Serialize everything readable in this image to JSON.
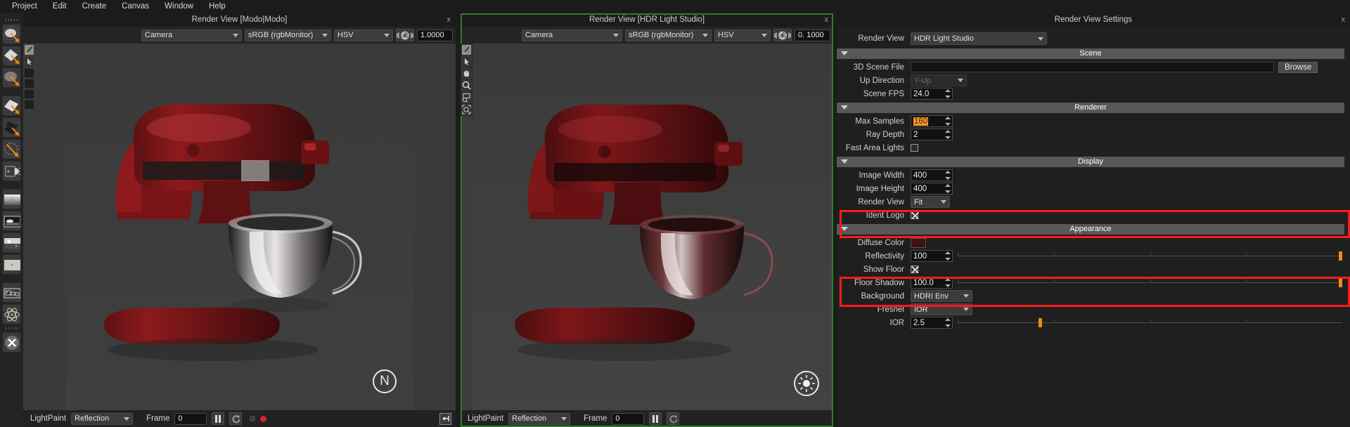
{
  "menubar": {
    "items": [
      "Project",
      "Edit",
      "Create",
      "Canvas",
      "Window",
      "Help"
    ]
  },
  "left_toolbar": {
    "tools": [
      {
        "name": "light-sphere-tool",
        "label": "Sphere Light"
      },
      {
        "name": "light-quad-tool",
        "label": "Quad Light"
      },
      {
        "name": "light-soft-tool",
        "label": "Soft Light"
      },
      {
        "name": "light-plane-tool",
        "label": "Plane Light"
      },
      {
        "name": "light-multi-tool",
        "label": "Multi Light"
      },
      {
        "name": "light-arc-tool",
        "label": "Arc Light"
      },
      {
        "name": "light-gradient-tool",
        "label": "Gradient Light"
      },
      {
        "name": "hdri-gradient-preset",
        "label": "Gradient Map"
      },
      {
        "name": "hdri-env-preset",
        "label": "HDRI Environment"
      },
      {
        "name": "hdri-sky-preset",
        "label": "Sky Preset"
      },
      {
        "name": "hdri-flat-preset",
        "label": "Flat Preset"
      },
      {
        "name": "layer-stack-tool",
        "label": "Layer Stack"
      },
      {
        "name": "atom-render-tool",
        "label": "Render Settings"
      },
      {
        "name": "close-tool",
        "label": "Close"
      }
    ]
  },
  "panel_modo": {
    "title": "Render View [Modo|Modo]",
    "close_label": "x",
    "camera": "Camera",
    "colorspace": "sRGB (rgbMonitor)",
    "mode": "HSV",
    "exposure": "1.0000",
    "exposure_icon": "aperture-icon",
    "bottom": {
      "lightpaint_label": "LightPaint",
      "paint_mode": "Reflection",
      "frame_label": "Frame",
      "frame_value": "0",
      "pause_icon": "pause-icon",
      "refresh_icon": "refresh-icon",
      "status_dot_idle": "idle-dot",
      "status_dot_rec": "record-dot",
      "collapse_icon": "collapse-left-icon"
    },
    "vtools": [
      {
        "name": "brush-tool"
      },
      {
        "name": "pointer-tool"
      },
      {
        "name": "pan-tool"
      },
      {
        "name": "zoom-tool"
      },
      {
        "name": "zoom-region-tool"
      },
      {
        "name": "zoom-fit-tool"
      }
    ],
    "watermark": "N"
  },
  "panel_hdrls": {
    "title": "Render View [HDR Light Studio]",
    "close_label": "x",
    "camera": "Camera",
    "colorspace": "sRGB (rgbMonitor)",
    "mode": "HSV",
    "exposure": "0. 1000",
    "exposure_icon": "aperture-icon",
    "bottom": {
      "lightpaint_label": "LightPaint",
      "paint_mode": "Reflection",
      "frame_label": "Frame",
      "frame_value": "0",
      "pause_icon": "pause-icon",
      "refresh_icon": "refresh-icon"
    },
    "vtools": [
      {
        "name": "brush-tool"
      },
      {
        "name": "pointer-tool"
      },
      {
        "name": "pan-tool"
      },
      {
        "name": "zoom-tool"
      },
      {
        "name": "zoom-region-tool"
      },
      {
        "name": "zoom-fit-tool"
      }
    ],
    "watermark": "sun-icon"
  },
  "settings": {
    "title": "Render View Settings",
    "close_label": "x",
    "render_view": {
      "label": "Render View",
      "value": "HDR Light Studio"
    },
    "groups": {
      "scene": "Scene",
      "renderer": "Renderer",
      "display": "Display",
      "appearance": "Appearance"
    },
    "scene": {
      "file_label": "3D Scene File",
      "file_value": "",
      "browse_label": "Browse",
      "up_direction_label": "Up Direction",
      "up_direction_value": "Y-Up",
      "fps_label": "Scene FPS",
      "fps_value": "24.0"
    },
    "renderer": {
      "max_samples_label": "Max Samples",
      "max_samples_value": "160",
      "ray_depth_label": "Ray Depth",
      "ray_depth_value": "2",
      "fast_area_lights_label": "Fast Area Lights",
      "fast_area_lights_checked": false
    },
    "display": {
      "image_width_label": "Image Width",
      "image_width_value": "400",
      "image_height_label": "Image Height",
      "image_height_value": "400",
      "render_view_label": "Render View",
      "render_view_value": "Fit",
      "ident_logo_label": "Ident Logo",
      "ident_logo_checked": true
    },
    "appearance": {
      "diffuse_color_label": "Diffuse Color",
      "diffuse_color_value": "#3d1212",
      "reflectivity_label": "Reflectivity",
      "reflectivity_value": "100",
      "show_floor_label": "Show Floor",
      "show_floor_checked": true,
      "floor_shadow_label": "Floor Shadow",
      "floor_shadow_value": "100.0",
      "background_label": "Background",
      "background_value": "HDRI Env",
      "fresnel_label": "Fresnel",
      "fresnel_value": "IOR",
      "ior_label": "IOR",
      "ior_value": "2.5"
    }
  },
  "colors": {
    "highlight_red": "#ff1a1a",
    "accent_orange": "#f08a12",
    "active_green": "#2f7d32",
    "panel_bg": "#1f1f1f",
    "group_header": "#585858"
  }
}
